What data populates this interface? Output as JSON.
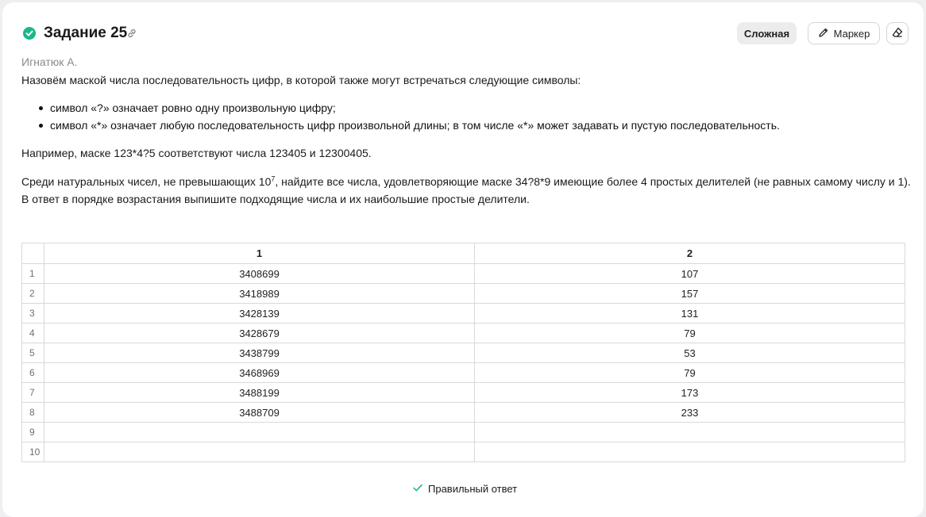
{
  "header": {
    "title": "Задание 25",
    "difficulty_label": "Сложная",
    "marker_label": "Маркер"
  },
  "author": "Игнатюк А.",
  "problem": {
    "intro": "Назовём маской числа последовательность цифр, в которой также могут встречаться следующие символы:",
    "bullets": [
      "символ «?» означает ровно одну произвольную цифру;",
      "символ «*» означает любую последовательность цифр произвольной длины; в том числе «*» может задавать и пустую последовательность."
    ],
    "example": "Например, маске 123*4?5 соответствуют числа 123405 и 12300405.",
    "task_part1": "Среди натуральных чисел, не превышающих 10",
    "task_sup": "7",
    "task_part2": ", найдите все числа, удовлетворяющие маске 34?8*9 имеющие более 4 простых делителей (не равных самому числу и 1). В ответ в порядке возрастания выпишите подходящие числа и их наибольшие простые делители."
  },
  "answer_table": {
    "columns": [
      "1",
      "2"
    ],
    "rows": [
      {
        "num": "1",
        "c1": "3408699",
        "c2": "107"
      },
      {
        "num": "2",
        "c1": "3418989",
        "c2": "157"
      },
      {
        "num": "3",
        "c1": "3428139",
        "c2": "131"
      },
      {
        "num": "4",
        "c1": "3428679",
        "c2": "79"
      },
      {
        "num": "5",
        "c1": "3438799",
        "c2": "53"
      },
      {
        "num": "6",
        "c1": "3468969",
        "c2": "79"
      },
      {
        "num": "7",
        "c1": "3488199",
        "c2": "173"
      },
      {
        "num": "8",
        "c1": "3488709",
        "c2": "233"
      },
      {
        "num": "9",
        "c1": "",
        "c2": ""
      },
      {
        "num": "10",
        "c1": "",
        "c2": ""
      }
    ]
  },
  "result": {
    "label": "Правильный ответ"
  },
  "colors": {
    "success": "#1ab78a",
    "border": "#d9d9dc",
    "muted": "#8a8a8e"
  }
}
